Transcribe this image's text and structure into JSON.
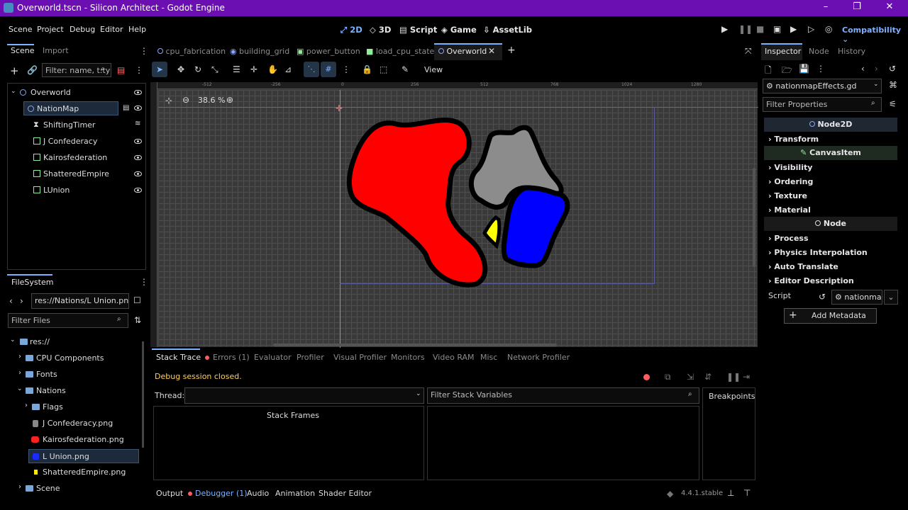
{
  "window": {
    "title": "Overworld.tscn - Silicon Architect - Godot Engine"
  },
  "menu": [
    "Scene",
    "Project",
    "Debug",
    "Editor",
    "Help"
  ],
  "modes": [
    {
      "label": "2D",
      "active": true
    },
    {
      "label": "3D"
    },
    {
      "label": "Script"
    },
    {
      "label": "Game"
    },
    {
      "label": "AssetLib"
    }
  ],
  "renderer": "Compatibility",
  "scene_dock": {
    "tabs": [
      "Scene",
      "Import"
    ],
    "filter_placeholder": "Filter: name, t:ty",
    "nodes": [
      "Overworld",
      "NationMap",
      "ShiftingTimer",
      "J Confederacy",
      "Kairosfederation",
      "ShatteredEmpire",
      "LUnion"
    ]
  },
  "editor_tabs": [
    "cpu_fabrication",
    "building_grid",
    "power_button",
    "load_cpu_state",
    "Overworld"
  ],
  "toolbar": {
    "view_label": "View"
  },
  "viewport": {
    "zoom": "38.6 %",
    "ruler_labels": [
      "-512",
      "-256",
      "0",
      "256",
      "512",
      "768",
      "1024",
      "1280"
    ]
  },
  "filesystem": {
    "title": "FileSystem",
    "path": "res://Nations/L Union.png",
    "filter_placeholder": "Filter Files",
    "items": [
      {
        "label": "res://",
        "type": "root"
      },
      {
        "label": "CPU Components",
        "type": "folder"
      },
      {
        "label": "Fonts",
        "type": "folder"
      },
      {
        "label": "Nations",
        "type": "folder"
      },
      {
        "label": "Flags",
        "type": "folder"
      },
      {
        "label": "J Confederacy.png",
        "type": "file",
        "color": "#888888"
      },
      {
        "label": "Kairosfederation.png",
        "type": "file",
        "color": "#ff2020"
      },
      {
        "label": "L Union.png",
        "type": "file",
        "color": "#1a2bff"
      },
      {
        "label": "ShatteredEmpire.png",
        "type": "file",
        "color": "#ffe600"
      },
      {
        "label": "Scene",
        "type": "folder"
      }
    ]
  },
  "debugger": {
    "tabs": [
      "Stack Trace",
      "Errors (1)",
      "Evaluator",
      "Profiler",
      "Visual Profiler",
      "Monitors",
      "Video RAM",
      "Misc",
      "Network Profiler"
    ],
    "status": "Debug session closed.",
    "thread_label": "Thread:",
    "filter_stack_placeholder": "Filter Stack Variables",
    "breakpoints": "Breakpoints",
    "stack_frames": "Stack Frames"
  },
  "bottom_tabs": [
    "Output",
    "Debugger (1)",
    "Audio",
    "Animation",
    "Shader Editor"
  ],
  "version": "4.4.1.stable",
  "inspector": {
    "tabs": [
      "Inspector",
      "Node",
      "History"
    ],
    "script_file": "nationmapEffects.gd",
    "filter_placeholder": "Filter Properties",
    "class_node2d": "Node2D",
    "section_transform": "Transform",
    "class_canvasitem": "CanvasItem",
    "canvas_sections": [
      "Visibility",
      "Ordering",
      "Texture",
      "Material"
    ],
    "class_node": "Node",
    "node_sections": [
      "Process",
      "Physics Interpolation",
      "Auto Translate",
      "Editor Description"
    ],
    "script_label": "Script",
    "script_value": "nationma",
    "add_metadata": "Add Metadata"
  },
  "colors": {
    "titlebar": "#6b0fb3",
    "accent": "#7fb1ff",
    "red_nation": "#ff0000",
    "gray_nation": "#8c8c8c",
    "blue_nation": "#0000ff",
    "yellow_nation": "#ffff00"
  }
}
